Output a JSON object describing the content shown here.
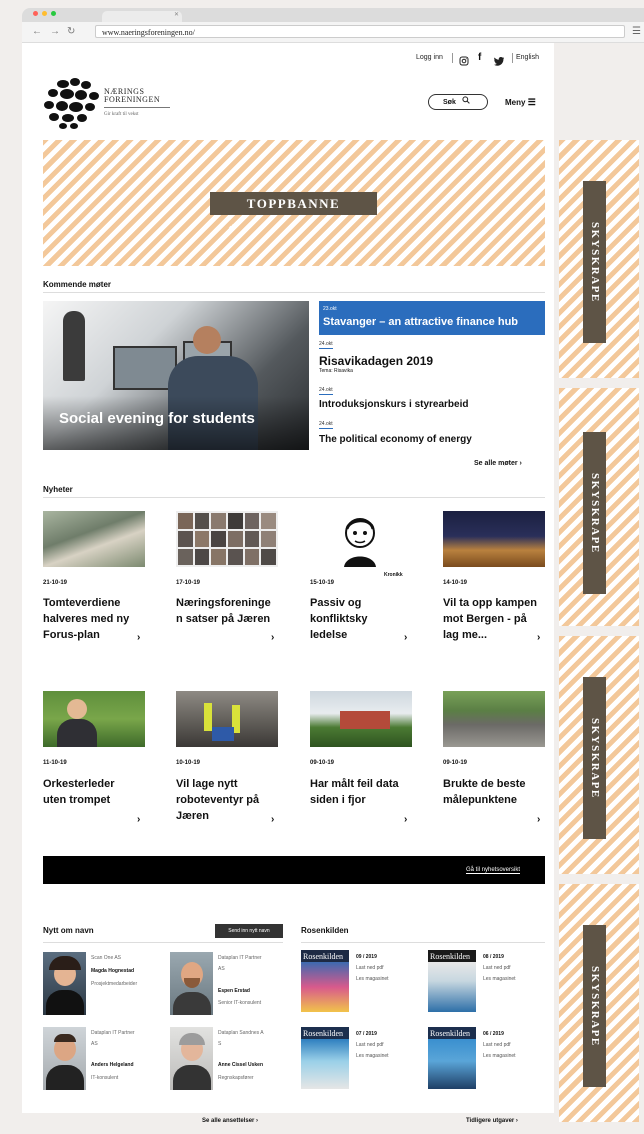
{
  "browser": {
    "url": "www.naeringsforeningen.no/",
    "dot_colors": [
      "#ff6158",
      "#ffbd2e",
      "#28c940"
    ]
  },
  "header": {
    "login": "Logg inn",
    "english": "English",
    "logo_line1": "NÆRINGS",
    "logo_line2": "FORENINGEN",
    "tagline": "Gir kraft til vekst",
    "search_label": "Søk",
    "menu_label": "Meny"
  },
  "ads": {
    "top_banner": "TOPPBANNE",
    "skyscraper": "SKYSKRAPE"
  },
  "meetings": {
    "title": "Kommende møter",
    "hero_caption": "Social evening for students",
    "featured": {
      "date": "23.okt",
      "title": "Stavanger – an attractive finance hub"
    },
    "events": [
      {
        "date": "24.okt",
        "title": "Risavikadagen 2019",
        "subtitle": "Tema: Risavika"
      },
      {
        "date": "24.okt",
        "title": "Introduksjonskurs i styrearbeid"
      },
      {
        "date": "24.okt",
        "title": "The political economy of energy"
      }
    ],
    "see_all": "Se alle møter"
  },
  "news": {
    "title": "Nyheter",
    "kronikk": "Kronikk",
    "items": [
      {
        "date": "21-10-19",
        "lines": [
          "Tomteverdiene",
          "halveres med ny",
          "Forus-plan"
        ]
      },
      {
        "date": "17-10-19",
        "lines": [
          "Næringsforeninge",
          "n satser på Jæren"
        ]
      },
      {
        "date": "15-10-19",
        "lines": [
          "Passiv og",
          "konfliktsky",
          "ledelse"
        ]
      },
      {
        "date": "14-10-19",
        "lines": [
          "Vil ta opp kampen",
          "mot Bergen - på",
          "lag me..."
        ]
      },
      {
        "date": "11-10-19",
        "lines": [
          "Orkesterleder",
          "uten trompet"
        ]
      },
      {
        "date": "10-10-19",
        "lines": [
          "Vil lage nytt",
          "roboteventyr på",
          "Jæren"
        ]
      },
      {
        "date": "09-10-19",
        "lines": [
          "Har målt feil data",
          "siden i fjor"
        ]
      },
      {
        "date": "09-10-19",
        "lines": [
          "Brukte de beste",
          "målepunktene"
        ]
      }
    ],
    "overview_link": "Gå til nyhetsoversikt"
  },
  "names": {
    "title": "Nytt om navn",
    "send_button": "Send inn nytt navn",
    "people": [
      {
        "company": [
          "Scan One AS"
        ],
        "name": "Magda Hognestad",
        "role": "Prosjektmedarbeider"
      },
      {
        "company": [
          "Dataplan IT Partner",
          "AS"
        ],
        "name": "Espen Erstad",
        "role": "Senior IT-konsulent"
      },
      {
        "company": [
          "Dataplan IT Partner",
          "AS"
        ],
        "name": "Anders Helgeland",
        "role": "IT-konsulent"
      },
      {
        "company": [
          "Dataplan Sandnes A",
          "S"
        ],
        "name": "Anne Cissel Usken",
        "role": "Regnskapsfører"
      }
    ],
    "see_all": "Se alle ansettelser"
  },
  "rosenkilden": {
    "title": "Rosenkilden",
    "mag_name": "Rosenkilden",
    "issues": [
      {
        "issue": "09 / 2019",
        "pdf": "Last ned pdf",
        "read": "Les magasinet"
      },
      {
        "issue": "08 / 2019",
        "pdf": "Last ned pdf",
        "read": "Les magasinet"
      },
      {
        "issue": "07 / 2019",
        "pdf": "Last ned pdf",
        "read": "Les magasinet"
      },
      {
        "issue": "06 / 2019",
        "pdf": "Last ned pdf",
        "read": "Les magasinet"
      }
    ],
    "earlier": "Tidligere utgaver"
  },
  "colors": {
    "accent_blue": "#2b6dbd",
    "ad_label": "#5e5446",
    "stripe": "#f3c89a"
  }
}
